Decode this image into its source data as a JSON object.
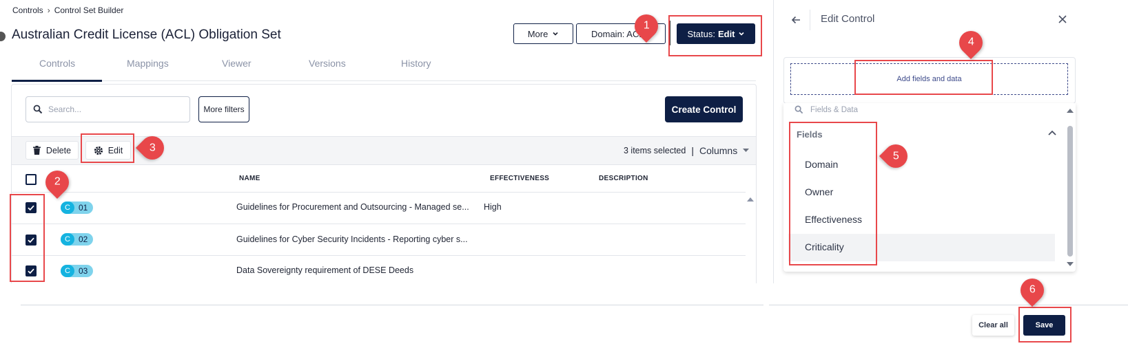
{
  "breadcrumb": {
    "root": "Controls",
    "current": "Control Set Builder"
  },
  "page": {
    "title": "Australian Credit License (ACL) Obligation Set"
  },
  "header_buttons": {
    "more": "More",
    "domain": "Domain: ACL",
    "status_prefix": "Status:",
    "status_value": "Edit"
  },
  "tabs": [
    "Controls",
    "Mappings",
    "Viewer",
    "Versions",
    "History"
  ],
  "toolbar": {
    "search_placeholder": "Search...",
    "more_filters": "More filters",
    "create_control": "Create Control",
    "delete": "Delete",
    "edit": "Edit",
    "selected_count": "3 items selected",
    "columns": "Columns"
  },
  "table": {
    "headers": {
      "name": "NAME",
      "effectiveness": "EFFECTIVENESS",
      "description": "DESCRIPTION"
    },
    "rows": [
      {
        "badge": "C",
        "id": "01",
        "name": "Guidelines for Procurement and Outsourcing - Managed se...",
        "effectiveness": "High",
        "description": ""
      },
      {
        "badge": "C",
        "id": "02",
        "name": "Guidelines for Cyber Security Incidents - Reporting cyber s...",
        "effectiveness": "",
        "description": ""
      },
      {
        "badge": "C",
        "id": "03",
        "name": "Data Sovereignty requirement of DESE Deeds",
        "effectiveness": "",
        "description": ""
      }
    ]
  },
  "side_panel": {
    "title": "Edit Control",
    "add_fields": "Add fields and data",
    "search_placeholder": "Fields & Data",
    "section_title": "Fields",
    "fields": [
      "Domain",
      "Owner",
      "Effectiveness",
      "Criticality"
    ],
    "clear_all": "Clear all",
    "save": "Save"
  },
  "annotations": [
    "1",
    "2",
    "3",
    "4",
    "5",
    "6"
  ],
  "colors": {
    "navy": "#0e1f45",
    "annotation": "#e8474a",
    "pill": "#15b3e0",
    "pill_light": "#7fd3ec"
  }
}
